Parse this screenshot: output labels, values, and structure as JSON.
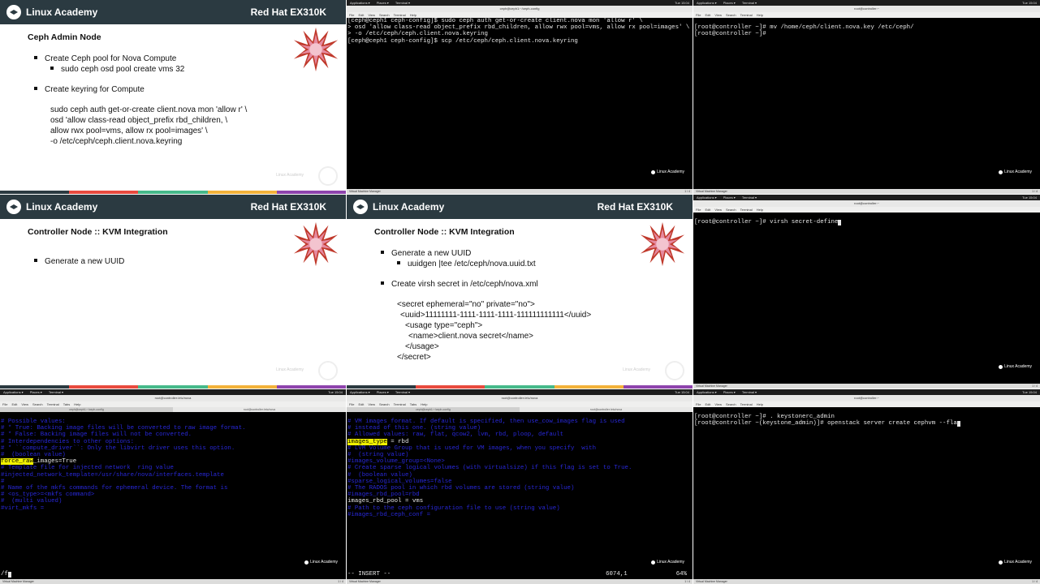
{
  "slide_common": {
    "brand": "Linux Academy",
    "course": "Red Hat EX310K",
    "watermark": "Linux Academy"
  },
  "slide1": {
    "title": "Ceph Admin Node",
    "bullets": [
      "Create Ceph pool for Nova Compute",
      "Create keyring for Compute"
    ],
    "sub_bullets": [
      "sudo ceph osd pool create vms 32"
    ],
    "code": [
      "sudo ceph auth get-or-create client.nova mon 'allow r' \\",
      "osd 'allow class-read object_prefix rbd_children, \\",
      "allow rwx pool=vms, allow rx pool=images' \\",
      "-o /etc/ceph/ceph.client.nova.keyring"
    ]
  },
  "slide2": {
    "title": "Controller Node :: KVM Integration",
    "bullets": [
      "Generate a new UUID"
    ]
  },
  "slide3": {
    "title": "Controller Node :: KVM Integration",
    "bullets": [
      "Generate a new UUID",
      "Create virsh secret in /etc/ceph/nova.xml"
    ],
    "sub_bullets": [
      "uuidgen |tee /etc/ceph/nova.uuid.txt"
    ],
    "code": [
      "<secret ephemeral=\"no\" private=\"no\">",
      "<uuid>11111111-1111-1111-1111-111111111111</uuid>",
      "<usage type=\"ceph\">",
      "<name>client.nova secret</name>",
      "</usage>",
      "</secret>"
    ]
  },
  "term_top_mid": {
    "lines": [
      "[ceph@ceph1 ceph-config]$ sudo ceph auth get-or-create client.nova mon 'allow r' \\",
      "> osd 'allow class-read object_prefix rbd_children, allow rwx pool=vms, allow rx pool=images' \\",
      "> -o /etc/ceph/ceph.client.nova.keyring",
      "[ceph@ceph1 ceph-config]$ scp /etc/ceph/ceph.client.nova.keyring"
    ],
    "watermark": "Linux Academy"
  },
  "term_top_right": {
    "lines": [
      "[root@controller ~]# mv /home/ceph/client.nova.key /etc/ceph/",
      "[root@controller ~]#"
    ],
    "watermark": "Linux Academy"
  },
  "term_mid_right": {
    "lines": [
      "[root@controller ~]# virsh secret-define"
    ],
    "watermark": "Linux Academy"
  },
  "term_bot_left": {
    "lines": [
      "# Possible values:",
      "",
      "# * True: Backing image files will be converted to raw image format.",
      "# * False: Backing image files will not be converted.",
      "",
      "# Interdependencies to other options:",
      "",
      "# * ``compute_driver``: Only the libvirt driver uses this option.",
      "#  (boolean value)",
      "#force_raw_images=true"
    ],
    "highlight": "force_raw",
    "value_line": "_images=True",
    "lines2": [
      "",
      "# Template file for injected network  ring value",
      "#injected_network_template=/usr/share/nova/interfaces.template",
      "",
      "#",
      "# Name of the mkfs commands for ephemeral device. The format is",
      "# <os_type>=<mkfs command>",
      "#  (multi valued)",
      "#virt_mkfs ="
    ],
    "cmdline": "/f",
    "watermark": "Linux Academy"
  },
  "term_bot_mid": {
    "lines_a": [
      "# VM images format. If default is specified, then use_cow_images flag is used",
      "# instead of this one. (string value)",
      "# Allowed values: raw, flat, qcow2, lvm, rbd, ploop, default"
    ],
    "highlight": "images_type",
    "value_line": " = rbd",
    "lines_b": [
      "",
      "# LVM Volume Group that is used for VM images, when you specify  with",
      "#  (string value)",
      "#images_volume_group=<None>",
      "",
      "# Create sparse logical volumes (with virtualsize) if this flag is set to True.",
      "#  (boolean value)",
      "#sparse_logical_volumes=false",
      "",
      "# The RADOS pool in which rbd volumes are stored (string value)",
      "#images_rbd_pool=rbd"
    ],
    "pool_line": "images_rbd_pool = vms",
    "lines_c": [
      "",
      "# Path to the ceph configuration file to use (string value)",
      "#images_rbd_ceph_conf ="
    ],
    "status_mode": "-- INSERT --",
    "status_pos": "6074,1",
    "status_pct": "64%",
    "watermark": "Linux Academy"
  },
  "term_bot_right": {
    "lines": [
      "[root@controller ~]# . keystonerc_admin",
      "[root@controller ~(keystone_admin)]# openstack server create cephvm --fla"
    ],
    "watermark": "Linux Academy"
  },
  "gnome": {
    "applications": "Applications ▾",
    "places": "Places ▾",
    "terminal": "Terminal ▾",
    "clock": "Tue 15:04",
    "menu": [
      "File",
      "Edit",
      "View",
      "Search",
      "Terminal",
      "Tabs",
      "Help"
    ],
    "title_ceph": "ceph@ceph1:~/ceph-config",
    "title_ctrl": "root@controller:~",
    "title_ctrl_etc": "root@controller:/etc/nova",
    "taskbar_left": "Virtual Machine Manager",
    "taskbar_page": "1 / 4"
  }
}
